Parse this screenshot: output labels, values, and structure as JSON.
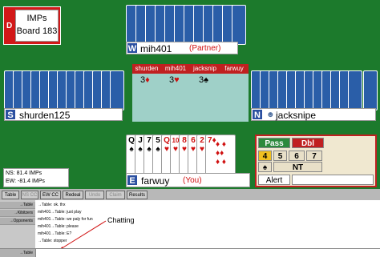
{
  "scoring": {
    "mode": "IMPs",
    "board": "Board 183",
    "dealer_letter": "D"
  },
  "north": {
    "letter": "W",
    "name": "mih401",
    "role": "(Partner)"
  },
  "west": {
    "letter": "S",
    "name": "shurden125"
  },
  "east": {
    "letter": "N",
    "name": "jacksnipe"
  },
  "south": {
    "letter": "E",
    "name": "farwuy",
    "role": "(You)"
  },
  "bidding": {
    "headers": [
      "shurden",
      "mih401",
      "jacksnip",
      "farwuy"
    ],
    "bids": [
      {
        "level": "3",
        "suit": "♦",
        "color": "#d01010"
      },
      {
        "level": "3",
        "suit": "♥",
        "color": "#d01010"
      },
      {
        "level": "3",
        "suit": "♠",
        "color": "#000000"
      }
    ]
  },
  "hand": [
    {
      "rank": "Q",
      "suit": "♠",
      "red": false
    },
    {
      "rank": "J",
      "suit": "♠",
      "red": false
    },
    {
      "rank": "7",
      "suit": "♠",
      "red": false
    },
    {
      "rank": "5",
      "suit": "♠",
      "red": false
    },
    {
      "rank": "Q",
      "suit": "♥",
      "red": true
    },
    {
      "rank": "10",
      "suit": "♥",
      "red": true
    },
    {
      "rank": "8",
      "suit": "♥",
      "red": true
    },
    {
      "rank": "6",
      "suit": "♥",
      "red": true
    },
    {
      "rank": "2",
      "suit": "♥",
      "red": true
    },
    {
      "rank": "7",
      "suit": "♦",
      "red": true
    }
  ],
  "bid_box": {
    "pass": "Pass",
    "dbl": "Dbl",
    "levels": [
      "4",
      "5",
      "6",
      "7"
    ],
    "suits": [
      "♠"
    ],
    "nt": "NT",
    "alert": "Alert"
  },
  "score": {
    "ns": "NS: 81.4 IMPs",
    "ew": "EW: -81.4 IMPs"
  },
  "tabs": [
    {
      "label": "Table",
      "disabled": false
    },
    {
      "label": "NS CC",
      "disabled": true
    },
    {
      "label": "EW CC",
      "disabled": false
    },
    {
      "label": "Redeal",
      "disabled": false
    },
    {
      "label": "Undo",
      "disabled": true
    },
    {
      "label": "Claim",
      "disabled": true
    },
    {
      "label": "Results",
      "disabled": false
    }
  ],
  "channels": [
    "→Table",
    "→Kibitzers",
    "→Opponents"
  ],
  "chat_lines": [
    "→Table: ok. thx",
    "mih401→Table: just play",
    "mih401→Table: we paly for fun",
    "mih401→Table: please",
    "mih401→Table: E?",
    "→Table: stopper"
  ],
  "annotation": "Chatting",
  "input_channel": "→Table",
  "colors": {
    "felt": "#1c7a2c",
    "card_back": "#2a5ea8",
    "bid_header": "#c02020",
    "seat_letter": "#c02020"
  }
}
